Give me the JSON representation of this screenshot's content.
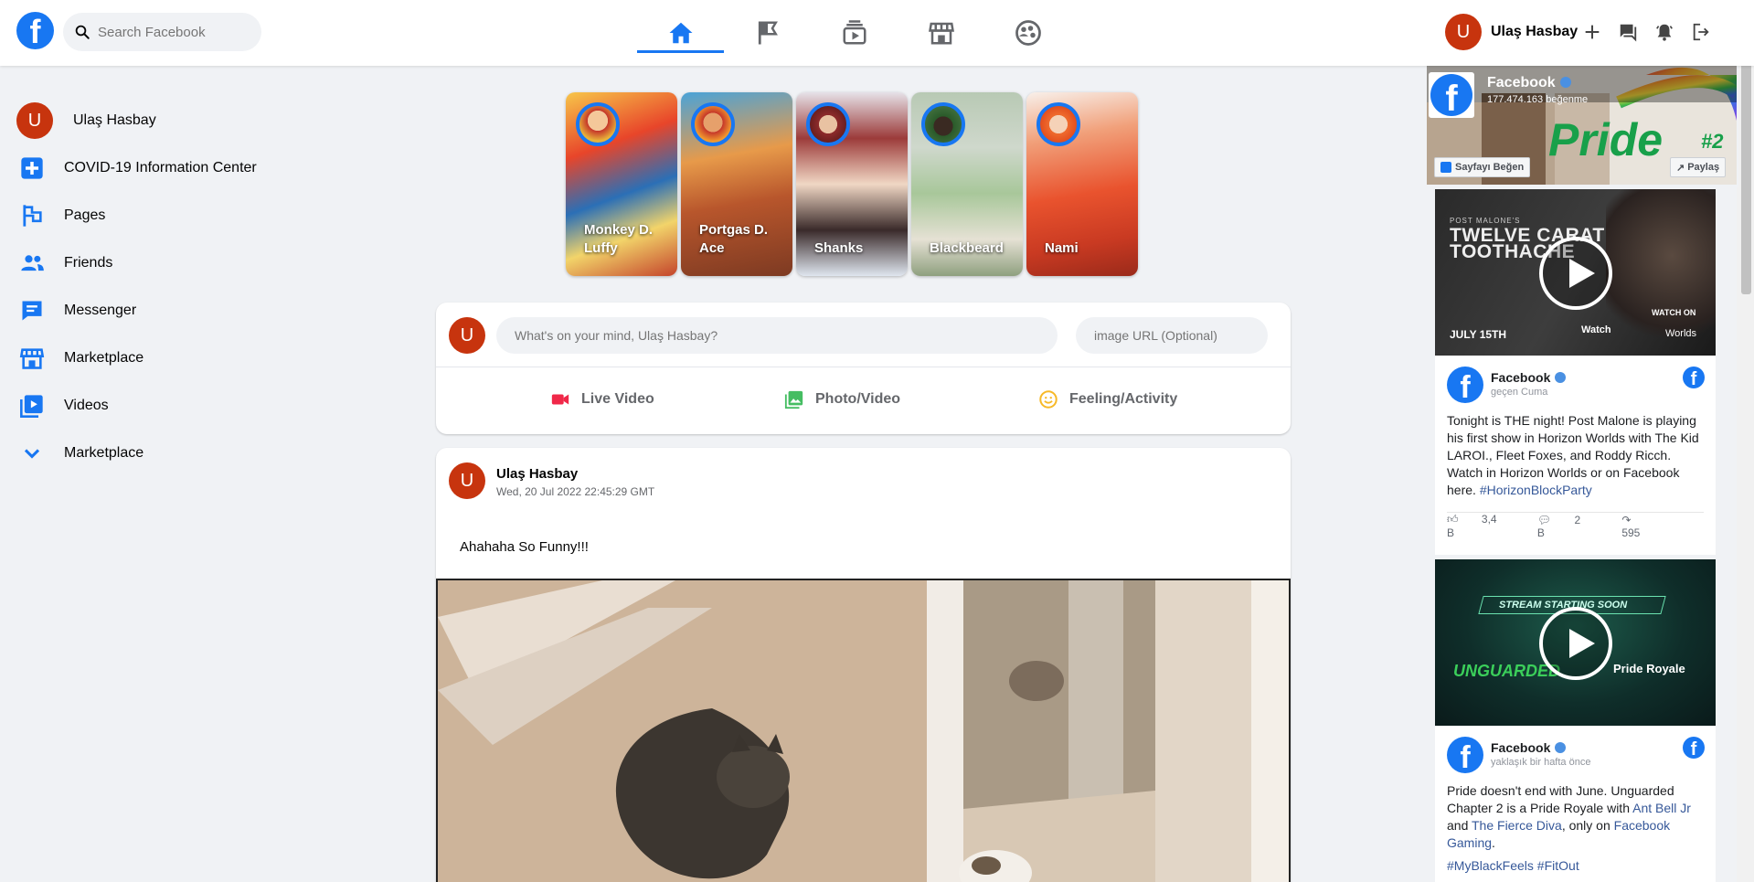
{
  "header": {
    "search_placeholder": "Search Facebook",
    "profile_name": "Ulaş Hasbay",
    "avatar_letter": "U",
    "nav_tabs": [
      "home-icon",
      "flag-icon",
      "watch-icon",
      "marketplace-icon",
      "groups-icon"
    ],
    "active_tab": "home-icon",
    "right_icons": [
      "plus-icon",
      "messenger-icon",
      "bell-icon",
      "logout-icon"
    ]
  },
  "sidebar": {
    "profile_name": "Ulaş Hasbay",
    "items": [
      {
        "label": "COVID-19 Information Center",
        "icon": "covid-plus-icon"
      },
      {
        "label": "Pages",
        "icon": "pages-flag-icon"
      },
      {
        "label": "Friends",
        "icon": "friends-icon"
      },
      {
        "label": "Messenger",
        "icon": "messenger-icon"
      },
      {
        "label": "Marketplace",
        "icon": "marketplace-icon"
      },
      {
        "label": "Videos",
        "icon": "videos-icon"
      },
      {
        "label": "Marketplace",
        "icon": "chevron-down-icon"
      }
    ]
  },
  "stories": [
    {
      "name": "Monkey D. Luffy"
    },
    {
      "name": "Portgas D. Ace"
    },
    {
      "name": "Shanks"
    },
    {
      "name": "Blackbeard"
    },
    {
      "name": "Nami"
    }
  ],
  "composer": {
    "placeholder": "What's on your mind, Ulaş Hasbay?",
    "image_placeholder": "image URL (Optional)",
    "live_video": "Live Video",
    "photo_video": "Photo/Video",
    "feeling_activity": "Feeling/Activity"
  },
  "post": {
    "author": "Ulaş Hasbay",
    "timestamp": "Wed, 20 Jul 2022 22:45:29 GMT",
    "text": "Ahahaha So Funny!!!"
  },
  "page_plugin": {
    "name": "Facebook",
    "likes": "177.474.163 beğenme",
    "like_button": "Sayfayı Beğen",
    "share_button": "Paylaş",
    "banner_text": "Pride",
    "banner_badge": "#2"
  },
  "feed_posts": [
    {
      "page": "Facebook",
      "when": "geçen Cuma",
      "thumb_title": "TWELVE CARAT TOOTHACHE",
      "thumb_sub": "POST MALONE'S",
      "thumb_date": "JULY 15TH",
      "thumb_watch": "Watch",
      "thumb_worlds": "Worlds",
      "thumb_watch_on": "WATCH ON",
      "text": "Tonight is THE night! Post Malone is playing his first show in Horizon Worlds with The Kid LAROI., Fleet Foxes, and Roddy Ricch. Watch in Horizon Worlds or on Facebook here.",
      "hashtag": "#HorizonBlockParty",
      "likes": "3,4 B",
      "comments": "2 B",
      "shares": "595"
    },
    {
      "page": "Facebook",
      "when": "yaklaşık bir hafta önce",
      "thumb_title": "STREAM STARTING SOON",
      "thumb_left": "UNGUARDED",
      "thumb_right": "Pride Royale",
      "text_1": "Pride doesn't end with June. Unguarded Chapter 2 is a Pride Royale with",
      "link_1": "Ant Bell Jr",
      "text_2": "and",
      "link_2": "The Fierce Diva",
      "text_3": ", only on",
      "link_3": "Facebook Gaming",
      "text_4": ".",
      "hashtags": "#MyBlackFeels #FitOut"
    }
  ],
  "colors": {
    "brand": "#1877f2",
    "avatar": "#c7340e",
    "live": "#f02849",
    "photo": "#45bd62",
    "feeling": "#f7b928"
  }
}
